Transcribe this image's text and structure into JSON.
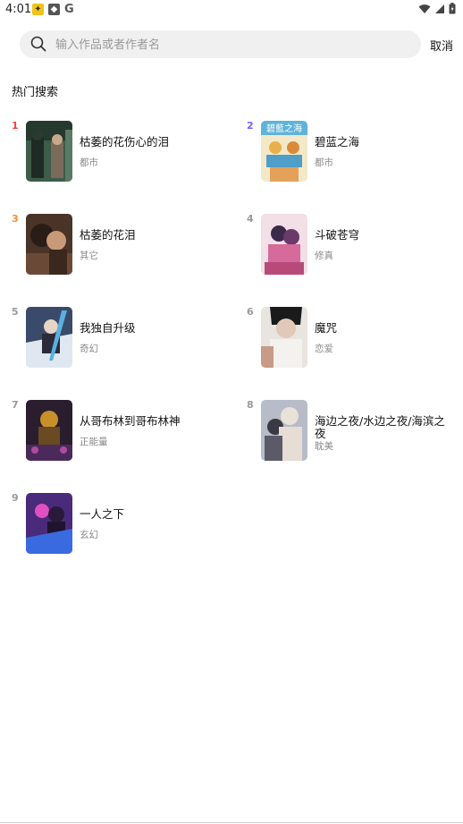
{
  "status": {
    "time": "4:01"
  },
  "search": {
    "placeholder": "输入作品或者作者名",
    "cancel_label": "取消"
  },
  "section_title": "热门搜索",
  "hot_items": [
    {
      "rank": "1",
      "title": "枯萎的花伤心的泪",
      "genre": "都市",
      "rank_color": "#ff3b3b"
    },
    {
      "rank": "2",
      "title": "碧蓝之海",
      "genre": "都市",
      "rank_color": "#7b5cff"
    },
    {
      "rank": "3",
      "title": "枯萎的花泪",
      "genre": "其它",
      "rank_color": "#ff8a2b"
    },
    {
      "rank": "4",
      "title": "斗破苍穹",
      "genre": "修真",
      "rank_color": "#9a9a9a"
    },
    {
      "rank": "5",
      "title": "我独自升级",
      "genre": "奇幻",
      "rank_color": "#9a9a9a"
    },
    {
      "rank": "6",
      "title": "魔咒",
      "genre": "恋爱",
      "rank_color": "#9a9a9a"
    },
    {
      "rank": "7",
      "title": "从哥布林到哥布林神",
      "genre": "正能量",
      "rank_color": "#9a9a9a"
    },
    {
      "rank": "8",
      "title": "海边之夜/水边之夜/海滨之夜",
      "genre": "耽美",
      "rank_color": "#9a9a9a"
    },
    {
      "rank": "9",
      "title": "一人之下",
      "genre": "玄幻",
      "rank_color": "#9a9a9a"
    }
  ]
}
